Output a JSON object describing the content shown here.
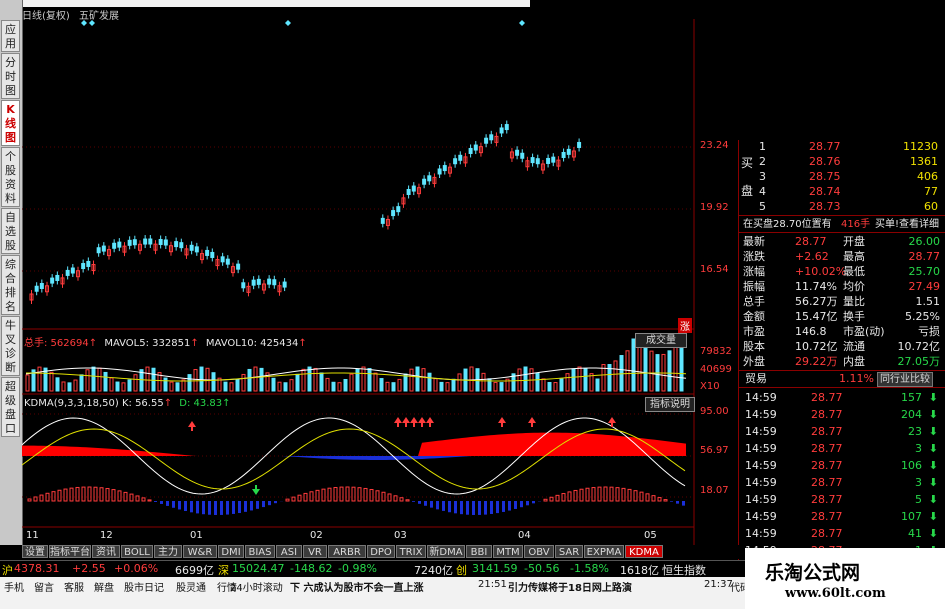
{
  "title": {
    "line": "日线(复权)",
    "stock": "五矿发展"
  },
  "left_tabs": [
    {
      "label": "应用",
      "active": false
    },
    {
      "label": "分时图",
      "active": false
    },
    {
      "label": "K线图",
      "active": true
    },
    {
      "label": "个股资料",
      "active": false
    },
    {
      "label": "自选股",
      "active": false
    },
    {
      "label": "综合排名",
      "active": false
    },
    {
      "label": "牛叉诊断",
      "active": false
    },
    {
      "label": "超级盘口",
      "active": false
    }
  ],
  "price_axis": [
    "23.24",
    "19.92",
    "16.54"
  ],
  "price_tag": "涨",
  "volume": {
    "label": "总手: 562694",
    "mavol5": "MAVOL5: 332851",
    "mavol10": "MAVOL10: 425434",
    "button": "成交量",
    "axis": [
      "79832",
      "40699",
      "X10"
    ]
  },
  "kdma": {
    "label": "KDMA(9,3,3,18,50) K: 56.55",
    "d": "D: 43.83",
    "button": "指标说明",
    "axis": [
      "95.00",
      "56.97",
      "18.07"
    ]
  },
  "x_axis": [
    "11",
    "12",
    "01",
    "02",
    "03",
    "04",
    "05"
  ],
  "quote": {
    "buy_label_1": "买",
    "buy_label_2": "盘",
    "buy_rows": [
      {
        "level": "1",
        "price": "28.77",
        "vol": "11230"
      },
      {
        "level": "2",
        "price": "28.76",
        "vol": "1361"
      },
      {
        "level": "3",
        "price": "28.75",
        "vol": "406"
      },
      {
        "level": "4",
        "price": "28.74",
        "vol": "77"
      },
      {
        "level": "5",
        "price": "28.73",
        "vol": "60"
      }
    ],
    "order_line": {
      "text": "在买盘28.70位置有",
      "qty": "416手",
      "btn1": "买单!",
      "btn2": "查看详细"
    },
    "stats": [
      {
        "l1": "最新",
        "v1": "28.77",
        "l2": "开盘",
        "v2": "26.00",
        "c1": "red",
        "c2": "green"
      },
      {
        "l1": "涨跌",
        "v1": "+2.62",
        "l2": "最高",
        "v2": "28.77",
        "c1": "red",
        "c2": "red"
      },
      {
        "l1": "涨幅",
        "v1": "+10.02%",
        "l2": "最低",
        "v2": "25.70",
        "c1": "red",
        "c2": "green"
      },
      {
        "l1": "振幅",
        "v1": "11.74%",
        "l2": "均价",
        "v2": "27.49",
        "c1": "white",
        "c2": "red"
      },
      {
        "l1": "总手",
        "v1": "56.27万",
        "l2": "量比",
        "v2": "1.51",
        "c1": "white",
        "c2": "white"
      },
      {
        "l1": "金额",
        "v1": "15.47亿",
        "l2": "换手",
        "v2": "5.25%",
        "c1": "white",
        "c2": "white"
      },
      {
        "l1": "市盈",
        "v1": "146.8",
        "l2": "市盈(动)",
        "v2": "亏损",
        "c1": "white",
        "c2": "white"
      },
      {
        "l1": "股本",
        "v1": "10.72亿",
        "l2": "流通",
        "v2": "10.72亿",
        "c1": "white",
        "c2": "white"
      },
      {
        "l1": "外盘",
        "v1": "29.22万",
        "l2": "内盘",
        "v2": "27.05万",
        "c1": "red",
        "c2": "green"
      }
    ],
    "industry": {
      "name": "贸易",
      "pct": "1.11%",
      "btn": "同行业比较"
    },
    "ticks": [
      {
        "time": "14:59",
        "price": "28.77",
        "vol": "157"
      },
      {
        "time": "14:59",
        "price": "28.77",
        "vol": "204"
      },
      {
        "time": "14:59",
        "price": "28.77",
        "vol": "23"
      },
      {
        "time": "14:59",
        "price": "28.77",
        "vol": "3"
      },
      {
        "time": "14:59",
        "price": "28.77",
        "vol": "106"
      },
      {
        "time": "14:59",
        "price": "28.77",
        "vol": "3"
      },
      {
        "time": "14:59",
        "price": "28.77",
        "vol": "5"
      },
      {
        "time": "14:59",
        "price": "28.77",
        "vol": "107"
      },
      {
        "time": "14:59",
        "price": "28.77",
        "vol": "41"
      },
      {
        "time": "14:59",
        "price": "28.77",
        "vol": "1"
      }
    ]
  },
  "indicator_tabs": [
    "设置",
    "指标平台",
    "资讯",
    "BOLL",
    "主力",
    "W&R",
    "DMI",
    "BIAS",
    "ASI",
    "VR",
    "ARBR",
    "DPO",
    "TRIX",
    "新DMA",
    "BBI",
    "MTM",
    "OBV",
    "SAR",
    "EXPMA",
    "KDMA"
  ],
  "index_bar": {
    "sh_label": "沪",
    "sh_val": "4378.31",
    "sh_chg": "+2.55",
    "sh_pct": "+0.06%",
    "sh_amt": "6699亿",
    "sz_label": "深",
    "sz_val": "15024.47",
    "sz_chg": "-148.62",
    "sz_pct": "-0.98%",
    "sz_amt": "7240亿",
    "cy_label": "创",
    "cy_val": "3141.59",
    "cy_chg": "-50.56",
    "cy_pct": "-1.58%",
    "cy_amt": "1618亿",
    "hk_label": "恒生指数"
  },
  "status": {
    "items": [
      "手机",
      "留言",
      "客服",
      "解盘",
      "股市日记",
      "股灵通",
      "行情"
    ],
    "ticker_time1": "24小时滚动",
    "news1": "下 六成认为股市不会一直上涨",
    "time2": "21:51",
    "news2": "引力传媒将于18日网上路演",
    "time3": "21:37",
    "tail": "代码"
  },
  "watermark": {
    "name": "乐淘公式网",
    "url": "www.60lt.com"
  },
  "colors": {
    "up": "#ff3c3c",
    "down": "#27d84a",
    "vol_down": "#5fe6ff",
    "kdma_band_up": "#ff0000",
    "kdma_band_down": "#1a2fd8"
  }
}
